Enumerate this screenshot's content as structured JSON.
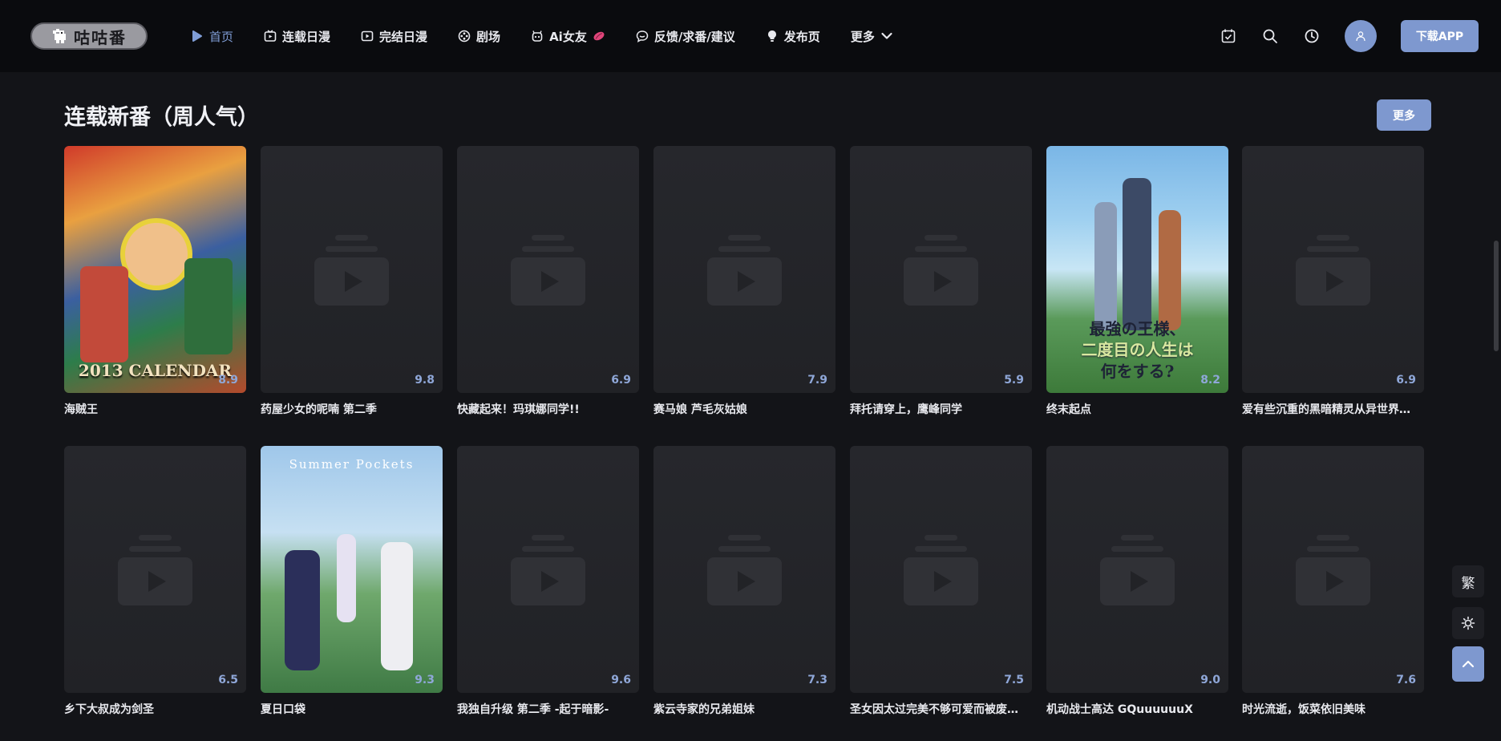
{
  "brand": {
    "logo_text": "咕咕番"
  },
  "nav": {
    "items": [
      {
        "label": "首页",
        "icon": "play-circle-icon",
        "active": true
      },
      {
        "label": "连载日漫",
        "icon": "tv-icon"
      },
      {
        "label": "完结日漫",
        "icon": "tv-icon"
      },
      {
        "label": "剧场",
        "icon": "film-reel-icon"
      },
      {
        "label": "Ai女友",
        "icon": "ai-robot-icon",
        "suffix_icon": "lips-icon"
      },
      {
        "label": "反馈/求番/建议",
        "icon": "chat-bubble-icon"
      },
      {
        "label": "发布页",
        "icon": "lightbulb-icon"
      },
      {
        "label": "更多",
        "icon": "chevron-down-icon"
      }
    ]
  },
  "header_actions": {
    "download_label": "下载APP"
  },
  "section": {
    "title": "连载新番（周人气）",
    "more_label": "更多"
  },
  "cards": [
    {
      "title": "海贼王",
      "score": "8.9",
      "art": "op"
    },
    {
      "title": "药屋少女的呢喃 第二季",
      "score": "9.8"
    },
    {
      "title": "快藏起来！玛琪娜同学!!",
      "score": "6.9"
    },
    {
      "title": "赛马娘 芦毛灰姑娘",
      "score": "7.9"
    },
    {
      "title": "拜托请穿上，鹰峰同学",
      "score": "5.9"
    },
    {
      "title": "终末起点",
      "score": "8.2",
      "art": "sk"
    },
    {
      "title": "爱有些沉重的黑暗精灵从异世界…",
      "score": "6.9"
    },
    {
      "title": "乡下大叔成为剑圣",
      "score": "6.5"
    },
    {
      "title": "夏日口袋",
      "score": "9.3",
      "art": "sp"
    },
    {
      "title": "我独自升级 第二季 -起于暗影-",
      "score": "9.6"
    },
    {
      "title": "紫云寺家的兄弟姐妹",
      "score": "7.3"
    },
    {
      "title": "圣女因太过完美不够可爱而被废…",
      "score": "7.5"
    },
    {
      "title": "机动战士高达 GQuuuuuuX",
      "score": "9.0"
    },
    {
      "title": "时光流逝，饭菜依旧美味",
      "score": "7.6"
    }
  ],
  "poster_art_text": {
    "op": "2013 CALENDAR",
    "sk_line1": "最強の王様、",
    "sk_line2": "二度目の人生は",
    "sk_line3": "何をする?",
    "sp": "Summer Pockets"
  },
  "floating": {
    "traditional_label": "繁"
  },
  "colors": {
    "accent": "#7e98cf",
    "score": "#8fa7d8",
    "background": "#131418",
    "header": "#0a0b0e"
  }
}
